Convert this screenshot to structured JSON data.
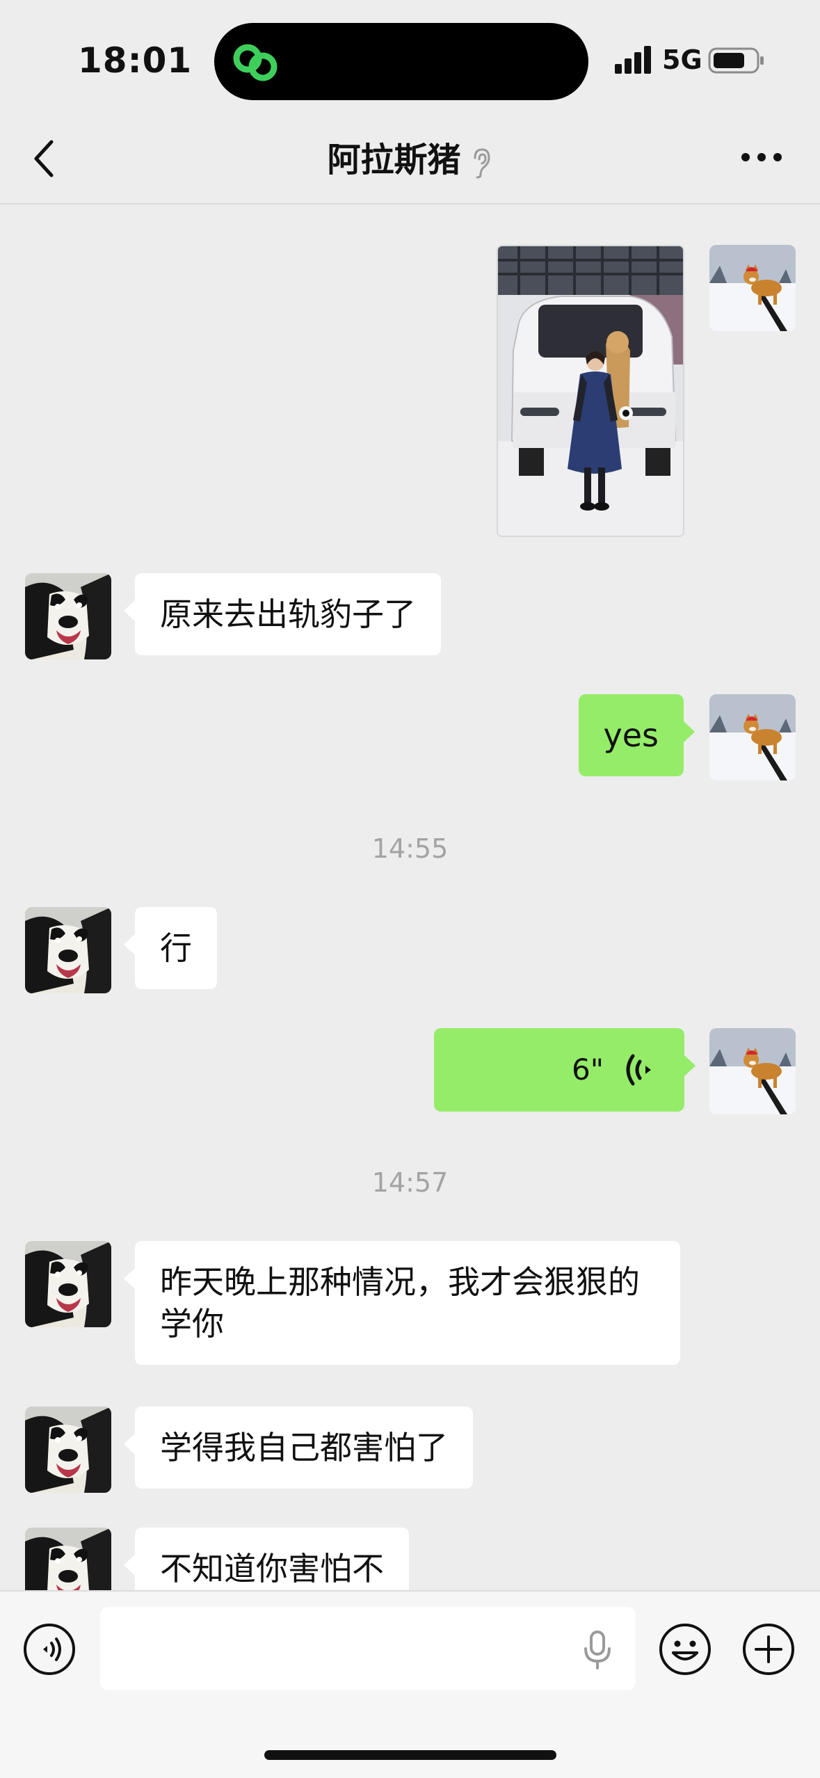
{
  "status_bar": {
    "time": "18:01",
    "network": "5G"
  },
  "header": {
    "title": "阿拉斯猪"
  },
  "messages": [
    {
      "side": "in",
      "text": "原来去出轨豹子了"
    },
    {
      "side": "out",
      "text": "yes"
    },
    {
      "side": "in",
      "text": "行"
    },
    {
      "side": "out",
      "voice_duration": "6\""
    },
    {
      "side": "in",
      "text": "昨天晚上那种情况，我才会狠狠的学你"
    },
    {
      "side": "in",
      "text": "学得我自己都害怕了"
    },
    {
      "side": "in",
      "text": "不知道你害怕不"
    }
  ],
  "timestamps": [
    "14:55",
    "14:57"
  ],
  "input": {
    "placeholder": ""
  },
  "colors": {
    "outgoing_bubble": "#95ec69",
    "incoming_bubble": "#ffffff",
    "background": "#ededed",
    "mini_program_icon": "#3ecf5b"
  },
  "icons": [
    "back-arrow-icon",
    "ear-icon",
    "more-icon",
    "voice-mode-icon",
    "microphone-icon",
    "emoji-icon",
    "plus-icon",
    "voice-wave-icon"
  ]
}
